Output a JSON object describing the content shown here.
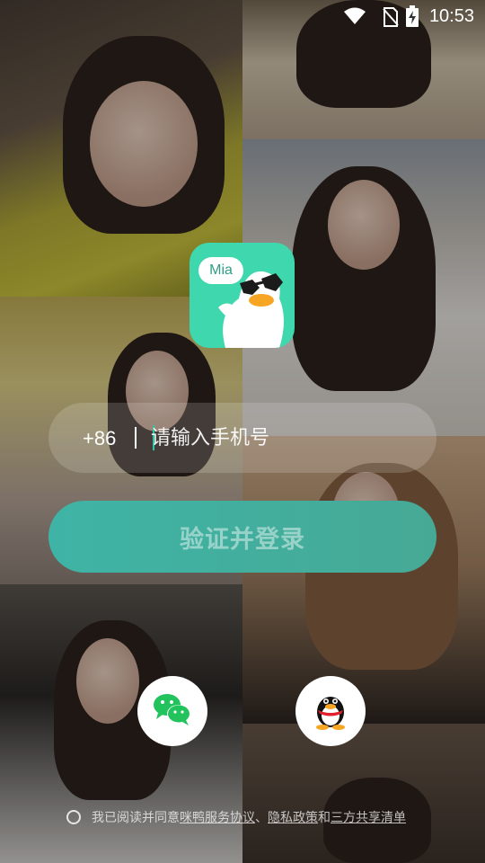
{
  "status_bar": {
    "time": "10:53",
    "icons": [
      "wifi-icon",
      "no-sim-icon",
      "battery-charging-icon"
    ]
  },
  "logo": {
    "bubble_text": "Mia",
    "icon": "duck-mascot-logo",
    "color": "#3fd7ad"
  },
  "phone_login": {
    "country_code": "+86",
    "value": "",
    "placeholder": "请输入手机号"
  },
  "login_button": {
    "label": "验证并登录",
    "color": "#43af9e"
  },
  "social_login": [
    {
      "name": "wechat",
      "icon": "wechat-icon"
    },
    {
      "name": "qq",
      "icon": "qq-penguin-icon"
    }
  ],
  "agreement": {
    "prefix": "我已阅读并同意",
    "service_link": "咪鸭服务协议",
    "separator": "、",
    "privacy_link": "隐私政策",
    "conjunction": "和",
    "third_party_link": "三方共享清单"
  }
}
